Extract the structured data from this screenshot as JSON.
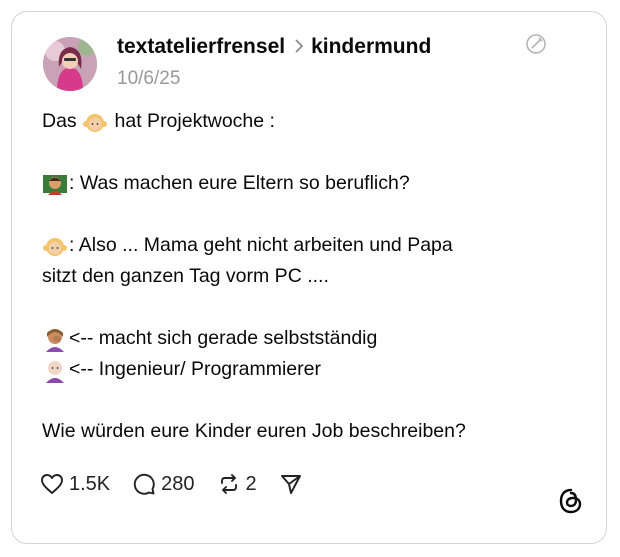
{
  "post": {
    "author": "textatelierfrensel",
    "community": "kindermund",
    "date": "10/6/25",
    "lines": {
      "l1": "Das",
      "l1b": "hat Projektwoche :",
      "l2": ": Was machen eure Eltern so beruflich?",
      "l3": ": Also ... Mama geht nicht arbeiten und Papa",
      "l4": "sitzt den ganzen Tag vorm PC ....",
      "l5": "<-- macht sich gerade selbstständig",
      "l6": "<-- Ingenieur/ Programmierer",
      "l7": "Wie würden eure Kinder euren Job beschreiben?"
    }
  },
  "actions": {
    "likes": "1.5K",
    "comments": "280",
    "reposts": "2"
  },
  "icons": [
    "heart-icon",
    "comment-icon",
    "repost-icon",
    "send-icon",
    "edit-disabled-icon",
    "threads-logo-icon"
  ]
}
